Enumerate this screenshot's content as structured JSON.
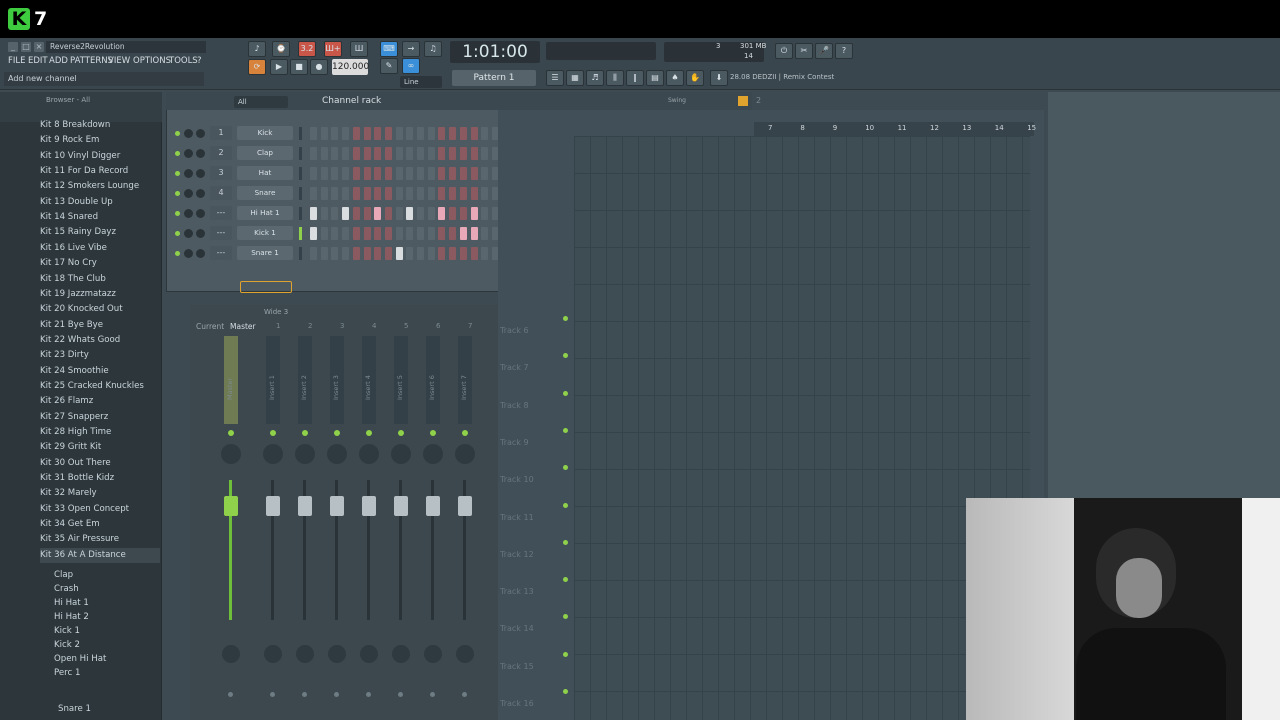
{
  "overlay": {
    "logo": "K",
    "logo_number": "7"
  },
  "window": {
    "title": "Reverse2Revolution",
    "hint": "Add new channel"
  },
  "menu": [
    "FILE",
    "EDIT",
    "ADD",
    "PATTERNS",
    "VIEW",
    "OPTIONS",
    "TOOLS",
    "?"
  ],
  "toolbar": {
    "time": "1:01:00",
    "tempo": "120.000",
    "pattern": "Pattern 1",
    "snap": "Line",
    "cpu_top": "3",
    "mem": "301 MB",
    "poly": "14",
    "news": "28.08  DEDZII | Remix Contest",
    "btn_a": "3.2",
    "btn_b": "Ш+"
  },
  "browser": {
    "title": "Browser - All",
    "items": [
      "Kit 8 Breakdown",
      "Kit 9 Rock Em",
      "Kit 10 Vinyl Digger",
      "Kit 11 For Da Record",
      "Kit 12 Smokers Lounge",
      "Kit 13 Double Up",
      "Kit 14 Snared",
      "Kit 15 Rainy Dayz",
      "Kit 16 Live Vibe",
      "Kit 17 No Cry",
      "Kit 18 The Club",
      "Kit 19 Jazzmatazz",
      "Kit 20 Knocked Out",
      "Kit 21 Bye Bye",
      "Kit 22 Whats Good",
      "Kit 23 Dirty",
      "Kit 24 Smoothie",
      "Kit 25 Cracked Knuckles",
      "Kit 26 Flamz",
      "Kit 27 Snapperz",
      "Kit 28 High Time",
      "Kit 29 Gritt Kit",
      "Kit 30 Out There",
      "Kit 31 Bottle Kidz",
      "Kit 32 Marely",
      "Kit 33 Open Concept",
      "Kit 34 Get Em",
      "Kit 35 Air Pressure",
      "Kit 36 At A Distance"
    ],
    "sub_items": [
      "Clap",
      "Crash",
      "Hi Hat 1",
      "Hi Hat 2",
      "Kick 1",
      "Kick 2",
      "Open Hi Hat",
      "Perc 1"
    ],
    "footer_item": "Snare 1"
  },
  "channel_rack": {
    "title": "Channel rack",
    "filter": "All",
    "swing_label": "Swing",
    "group": "2",
    "channels": [
      {
        "num": "1",
        "name": "Kick",
        "steps": []
      },
      {
        "num": "2",
        "name": "Clap",
        "steps": []
      },
      {
        "num": "3",
        "name": "Hat",
        "steps": []
      },
      {
        "num": "4",
        "name": "Snare",
        "steps": []
      },
      {
        "num": "---",
        "name": "Hi Hat 1",
        "steps": [
          0,
          3,
          6,
          9,
          12,
          15,
          19,
          22,
          25,
          28,
          31
        ]
      },
      {
        "num": "---",
        "name": "Kick 1",
        "steps": [
          0,
          14,
          15,
          18,
          21
        ]
      },
      {
        "num": "---",
        "name": "Snare 1",
        "steps": [
          8,
          24
        ]
      }
    ]
  },
  "mixer": {
    "preset": "Wide 3",
    "tabs": [
      "Current",
      "Master"
    ],
    "inserts": [
      "Master",
      "Insert 1",
      "Insert 2",
      "Insert 3",
      "Insert 4",
      "Insert 5",
      "Insert 6",
      "Insert 7"
    ],
    "numbers": [
      "1",
      "2",
      "3",
      "4",
      "5",
      "6",
      "7"
    ]
  },
  "playlist": {
    "bars": [
      "7",
      "8",
      "9",
      "10",
      "11",
      "12",
      "13",
      "14",
      "15"
    ],
    "tracks": [
      "Track 6",
      "Track 7",
      "Track 8",
      "Track 9",
      "Track 10",
      "Track 11",
      "Track 12",
      "Track 13",
      "Track 14",
      "Track 15",
      "Track 16"
    ]
  },
  "colors": {
    "accent": "#3fcb3f",
    "step_red": "#8a5a60",
    "step_gray": "#5a666d",
    "step_on": "#d9dde0",
    "step_pink": "#e8a8b8"
  }
}
